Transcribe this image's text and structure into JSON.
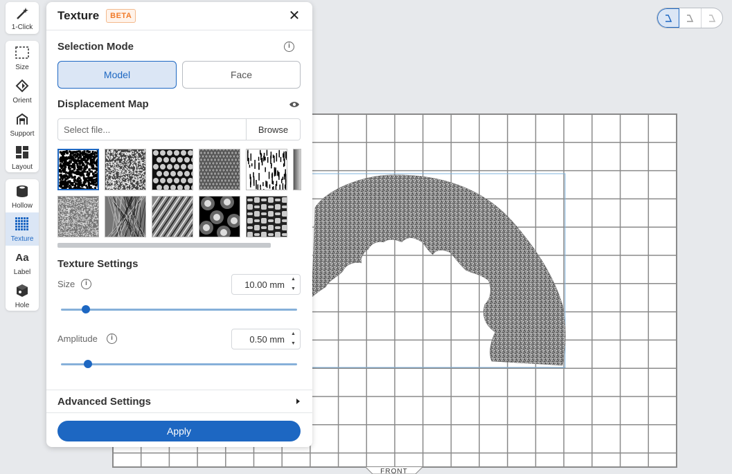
{
  "toolbar": {
    "one_click": "1-Click",
    "size": "Size",
    "orient": "Orient",
    "support": "Support",
    "layout": "Layout",
    "hollow": "Hollow",
    "texture": "Texture",
    "label": "Label",
    "hole": "Hole"
  },
  "panel": {
    "title": "Texture",
    "badge": "BETA",
    "selection_mode": {
      "label": "Selection Mode",
      "model": "Model",
      "face": "Face",
      "selected": "Model"
    },
    "displacement": {
      "label": "Displacement Map",
      "file_placeholder": "Select file...",
      "browse": "Browse"
    },
    "texture_settings": {
      "label": "Texture Settings",
      "size_label": "Size",
      "size_value": "10.00 mm",
      "size_slider_fraction": 0.09,
      "amplitude_label": "Amplitude",
      "amplitude_value": "0.50 mm",
      "amplitude_slider_fraction": 0.1
    },
    "advanced": "Advanced Settings",
    "apply": "Apply"
  },
  "viewport": {
    "front_label": "FRONT"
  },
  "colors": {
    "accent": "#1d67c2",
    "accent_light": "#dbe6f5",
    "beta": "#f07b2a"
  }
}
